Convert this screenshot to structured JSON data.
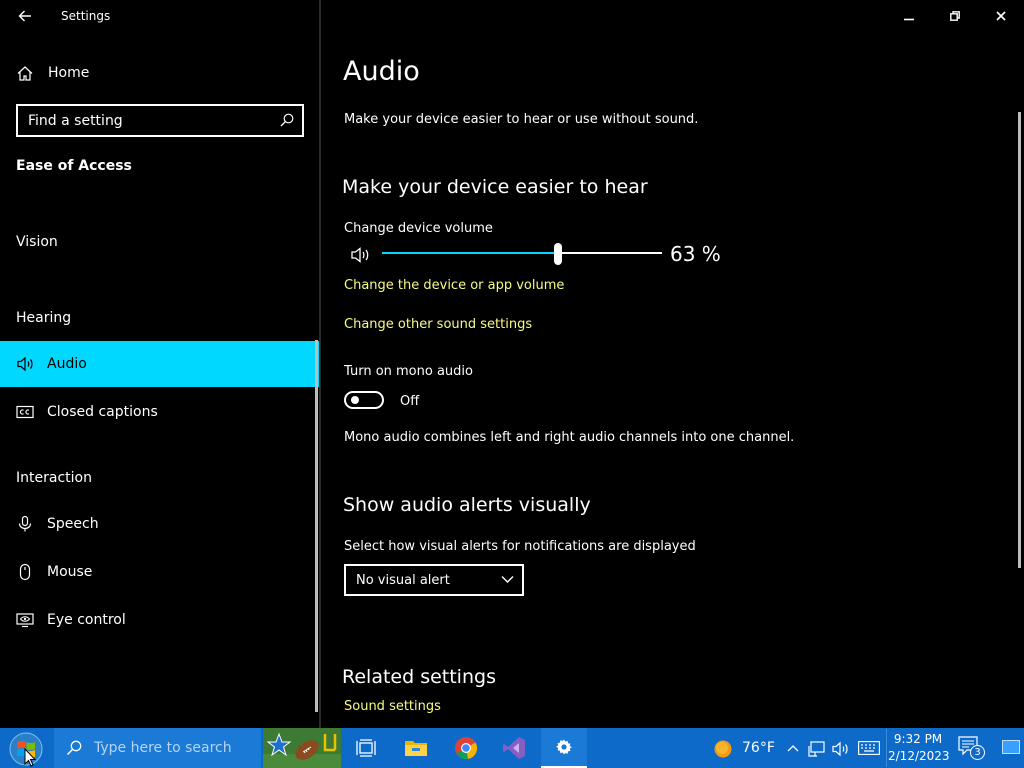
{
  "window": {
    "title": "Settings"
  },
  "sidebar": {
    "home_label": "Home",
    "search_placeholder": "Find a setting",
    "section_title": "Ease of Access",
    "groups": {
      "vision": "Vision",
      "hearing": "Hearing",
      "interaction": "Interaction"
    },
    "items": [
      {
        "label": "Audio",
        "icon": "speaker-icon",
        "active": true
      },
      {
        "label": "Closed captions",
        "icon": "closed-captions-icon",
        "active": false
      },
      {
        "label": "Speech",
        "icon": "microphone-icon",
        "active": false
      },
      {
        "label": "Mouse",
        "icon": "mouse-icon",
        "active": false
      },
      {
        "label": "Eye control",
        "icon": "eye-control-icon",
        "active": false
      }
    ]
  },
  "main": {
    "page_title": "Audio",
    "subtitle": "Make your device easier to hear or use without sound.",
    "section_hear": "Make your device easier to hear",
    "volume_label": "Change device volume",
    "volume_percent": 63,
    "volume_text": "63 %",
    "link_device_app_volume": "Change the device or app volume",
    "link_other_sound": "Change other sound settings",
    "mono_label": "Turn on mono audio",
    "mono_state": "Off",
    "mono_description": "Mono audio combines left and right audio channels into one channel.",
    "section_alerts": "Show audio alerts visually",
    "alerts_label": "Select how visual alerts for notifications are displayed",
    "alerts_selected": "No visual alert",
    "related_title": "Related settings",
    "link_sound_settings": "Sound settings"
  },
  "taskbar": {
    "search_placeholder": "Type here to search",
    "weather": "76°F",
    "time": "9:32 PM",
    "date": "2/12/2023",
    "notification_count": "3"
  },
  "colors": {
    "accent": "#00d8ff",
    "link": "#fafa85",
    "taskbar": "#0e6ac9"
  }
}
